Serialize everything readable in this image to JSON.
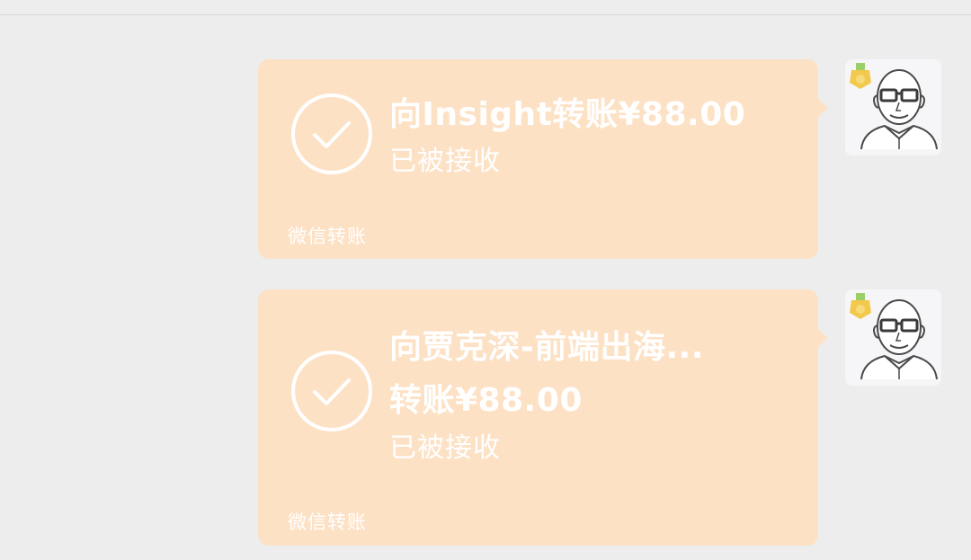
{
  "colors": {
    "background": "#ededed",
    "bubble": "#fde1c5",
    "text": "#ffffff",
    "avatar_bg": "#f6f6f8",
    "badge": "#f2c94c"
  },
  "messages": [
    {
      "title_lines": [
        "向Insight转账¥88.00"
      ],
      "status": "已被接收",
      "footer": "微信转账",
      "status_icon": "check-circle-icon",
      "avatar_icon": "bald-man-glasses-avatar"
    },
    {
      "title_lines": [
        "向贾克深-前端出海...",
        "转账¥88.00"
      ],
      "status": "已被接收",
      "footer": "微信转账",
      "status_icon": "check-circle-icon",
      "avatar_icon": "bald-man-glasses-avatar"
    }
  ]
}
